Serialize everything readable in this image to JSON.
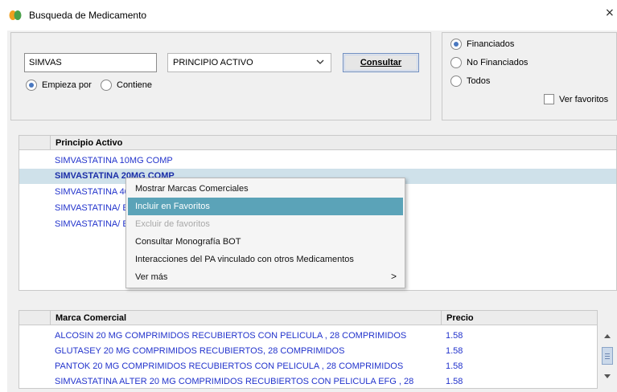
{
  "window": {
    "title": "Busqueda de Medicamento",
    "close_glyph": "×"
  },
  "search": {
    "value": "SIMVAS",
    "field_select": "PRINCIPIO ACTIVO",
    "button_label": "Consultar",
    "mode_options": [
      {
        "label": "Empieza por",
        "checked": true
      },
      {
        "label": "Contiene",
        "checked": false
      }
    ]
  },
  "filter": {
    "options": [
      {
        "label": "Financiados",
        "checked": true
      },
      {
        "label": "No Financiados",
        "checked": false
      },
      {
        "label": "Todos",
        "checked": false
      }
    ],
    "favorites_label": "Ver favoritos",
    "favorites_checked": false
  },
  "principios": {
    "header": "Principio Activo",
    "rows": [
      "SIMVASTATINA 10MG COMP",
      "SIMVASTATINA 20MG COMP",
      "SIMVASTATINA 40",
      "SIMVASTATINA/ E",
      "SIMVASTATINA/ E"
    ],
    "selected_index": 1
  },
  "context_menu": {
    "items": [
      {
        "label": "Mostrar Marcas Comerciales",
        "state": "normal"
      },
      {
        "label": "Incluir en Favoritos",
        "state": "highlighted"
      },
      {
        "label": "Excluir de favoritos",
        "state": "disabled"
      },
      {
        "label": "Consultar Monografía BOT",
        "state": "normal"
      },
      {
        "label": "Interacciones del PA vinculado con otros Medicamentos",
        "state": "normal"
      },
      {
        "label": "Ver más",
        "state": "submenu"
      }
    ],
    "submenu_arrow": ">"
  },
  "marcas": {
    "headers": [
      "Marca Comercial",
      "Precio"
    ],
    "rows": [
      {
        "name": "ALCOSIN 20 MG COMPRIMIDOS RECUBIERTOS CON PELICULA , 28 COMPRIMIDOS",
        "price": "1.58"
      },
      {
        "name": "GLUTASEY 20 MG COMPRIMIDOS RECUBIERTOS, 28 COMPRIMIDOS",
        "price": "1.58"
      },
      {
        "name": "PANTOK 20 MG COMPRIMIDOS RECUBIERTOS CON PELICULA , 28 COMPRIMIDOS",
        "price": "1.58"
      },
      {
        "name": "SIMVASTATINA ALTER 20 MG COMPRIMIDOS RECUBIERTOS CON PELICULA EFG , 28",
        "price": "1.58"
      }
    ]
  },
  "colors": {
    "link": "#2233cc",
    "selection": "#cfe1ea",
    "menu_highlight": "#5ba3b8",
    "accent": "#4a78c0"
  },
  "icons": {
    "app": "pill-leaf-icon",
    "close": "close-icon",
    "chevron": "chevron-down-icon"
  }
}
